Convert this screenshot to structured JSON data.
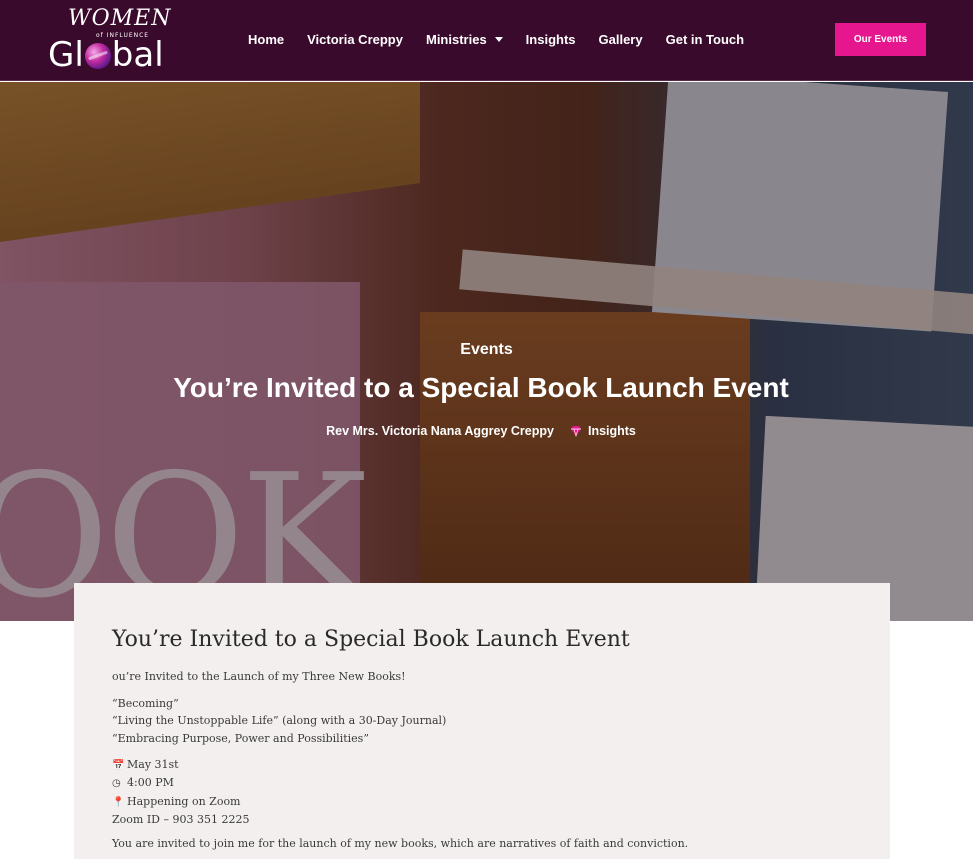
{
  "brand": {
    "logo_top": "WOMEN",
    "logo_sub": "of INFLUENCE",
    "logo_main_left": "Gl",
    "logo_main_right": "bal"
  },
  "nav": {
    "items": [
      {
        "label": "Home"
      },
      {
        "label": "Victoria Creppy"
      },
      {
        "label": "Ministries"
      },
      {
        "label": "Insights"
      },
      {
        "label": "Gallery"
      },
      {
        "label": "Get in Touch"
      }
    ],
    "cta_label": "Our Events"
  },
  "hero": {
    "category": "Events",
    "title": "You’re Invited to a Special Book Launch Event",
    "author": "Rev Mrs. Victoria Nana Aggrey Creppy",
    "tag": "Insights",
    "bg_text": "OOK"
  },
  "article": {
    "title": "You’re Invited to a Special Book Launch Event",
    "intro": "ou’re Invited to the Launch of my Three New Books!",
    "books": [
      "“Becoming”",
      "“Living the Unstoppable Life” (along with a 30-Day Journal)",
      "“Embracing Purpose, Power and Possibilities”"
    ],
    "details": {
      "date": "May 31st",
      "time": "4:00 PM",
      "location": "Happening on Zoom",
      "zoom_id": "Zoom ID – 903 351 2225"
    },
    "closing": "You are invited to join me for the launch of my new books, which are narratives of faith and conviction."
  },
  "colors": {
    "header_bg": "#3a0a2d",
    "accent": "#e6178e",
    "card_bg": "#f2efee"
  },
  "icons": [
    "calendar-icon",
    "clock-icon",
    "pin-icon",
    "gem-icon",
    "chevron-down-icon"
  ]
}
